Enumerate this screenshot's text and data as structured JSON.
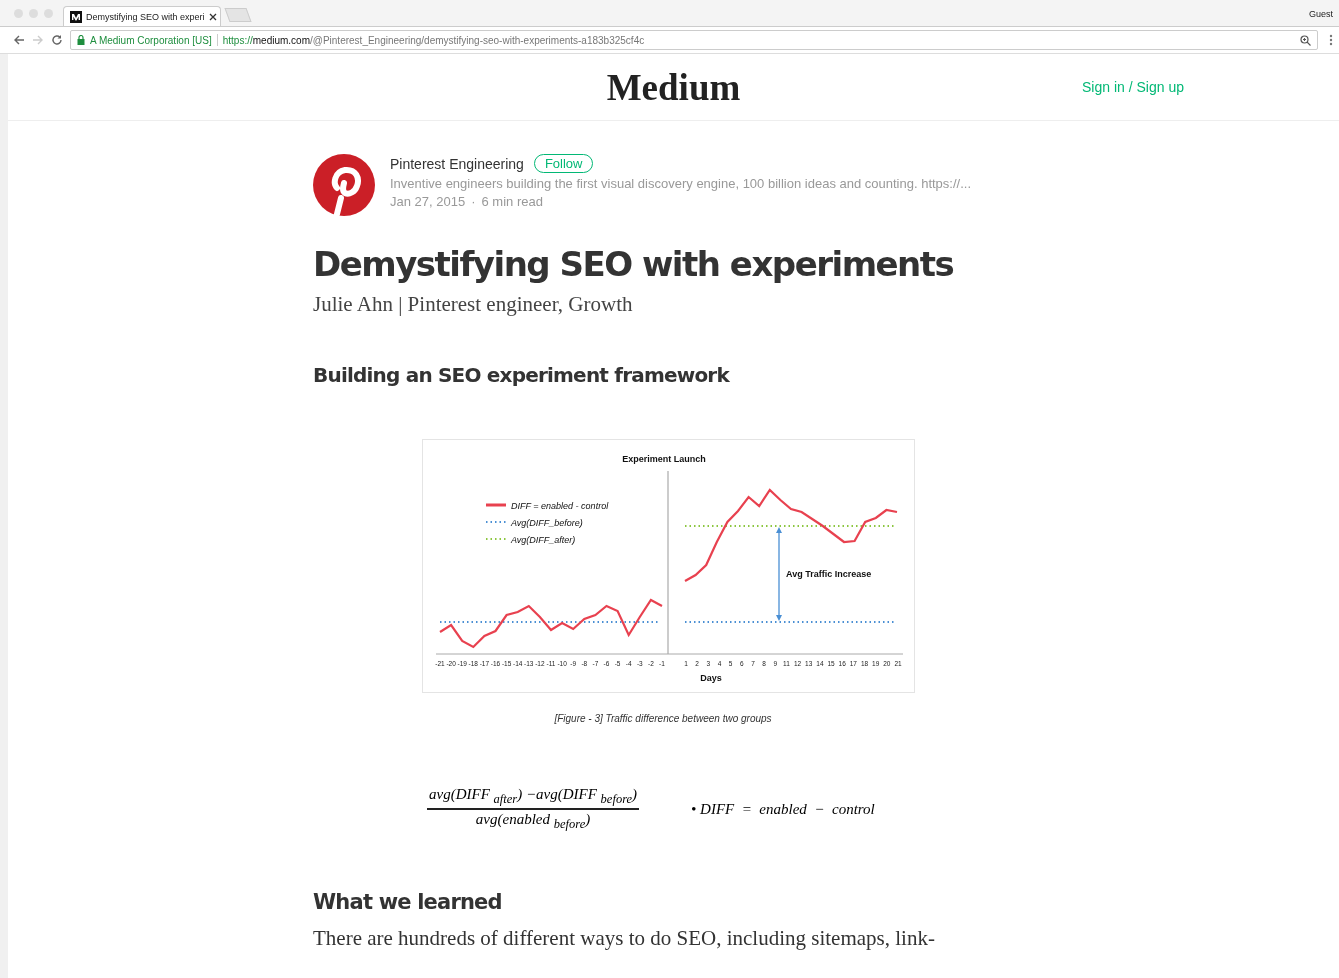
{
  "browser": {
    "tab_title": "Demystifying SEO with experi",
    "profile": "Guest",
    "security_label": "A Medium Corporation [US]",
    "url_scheme": "https://",
    "url_host": "medium.com",
    "url_path": "/@Pinterest_Engineering/demystifying-seo-with-experiments-a183b325cf4c"
  },
  "header": {
    "logo": "Medium",
    "sign_in": "Sign in / Sign up"
  },
  "author": {
    "name": "Pinterest Engineering",
    "follow": "Follow",
    "bio": "Inventive engineers building the first visual discovery engine, 100 billion ideas and counting. https://...",
    "date": "Jan 27, 2015",
    "separator": "·",
    "read_time": "6 min read"
  },
  "article": {
    "title": "Demystifying SEO with experiments",
    "byline": "Julie Ahn | Pinterest engineer, Growth",
    "section_heading": "Building an SEO experiment framework",
    "figure": {
      "title": "Experiment Launch",
      "legend": [
        "DIFF = enabled - control",
        "Avg(DIFF_before)",
        "Avg(DIFF_after)"
      ],
      "annotation": "Avg Traffic Increase",
      "xlabel": "Days",
      "xticks_before": [
        "-21",
        "-20",
        "-19",
        "-18",
        "-17",
        "-16",
        "-15",
        "-14",
        "-13",
        "-12",
        "-11",
        "-10",
        "-9",
        "-8",
        "-7",
        "-6",
        "-5",
        "-4",
        "-3",
        "-2",
        "-1"
      ],
      "xticks_after": [
        "1",
        "2",
        "3",
        "4",
        "5",
        "6",
        "7",
        "8",
        "9",
        "11",
        "12",
        "13",
        "14",
        "15",
        "16",
        "17",
        "18",
        "19",
        "20",
        "21"
      ],
      "caption": "[Figure - 3] Traffic difference between two groups"
    },
    "formula": {
      "numerator": "avg(DIFF $_{after}$) −avg(DIFF $_{before}$)",
      "denominator": "avg(enabled $_{before}$)",
      "definition": "• DIFF  =  enabled  −  control"
    },
    "second_heading": "What we learned",
    "paragraph": "There are hundreds of different ways to do SEO, including sitemaps, link-"
  }
}
